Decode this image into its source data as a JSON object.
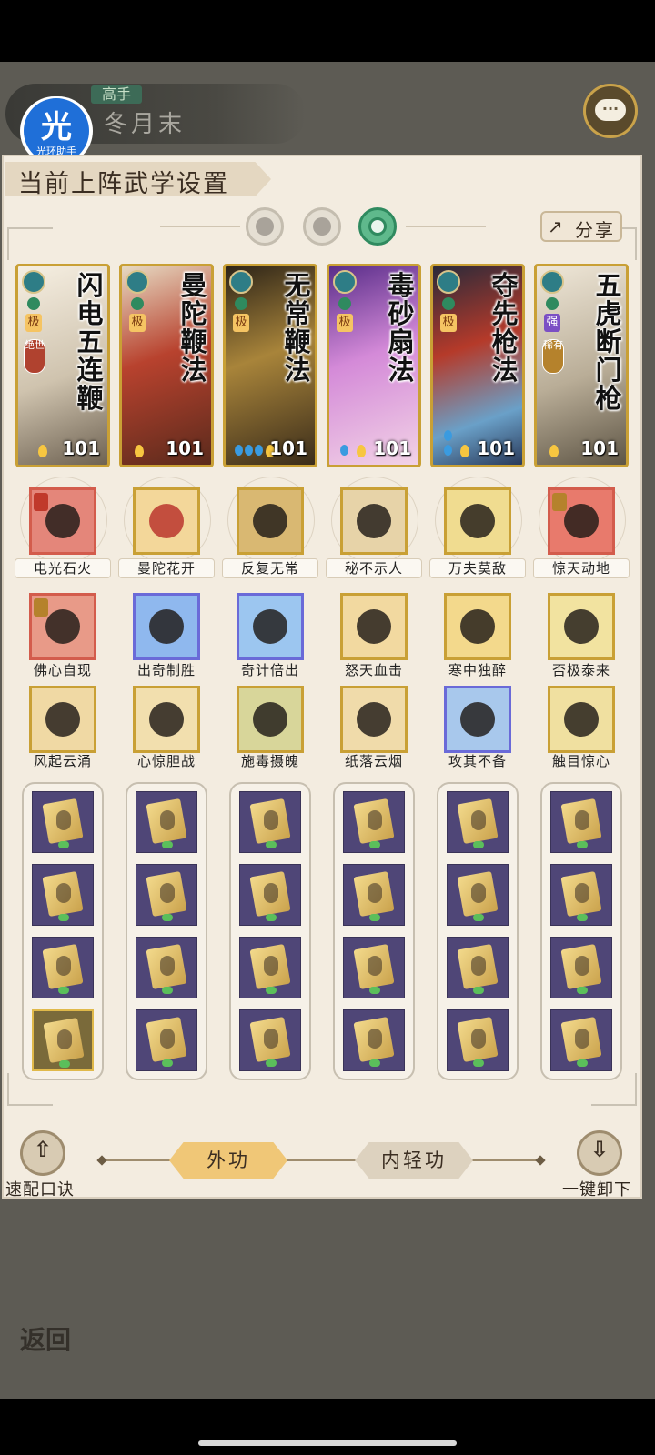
{
  "header": {
    "rank": "高手",
    "player_name": "冬月末",
    "assistant_glyph": "光",
    "assistant_caption": "光环助手"
  },
  "panel": {
    "title": "当前上阵武学设置",
    "share_label": "分享",
    "share_icon": "share-icon"
  },
  "cards": [
    {
      "name": "闪电五连鞭",
      "grade": "极",
      "seal": "绝世",
      "level": "101",
      "drops": 0
    },
    {
      "name": "曼陀鞭法",
      "grade": "极",
      "seal": "",
      "level": "101",
      "drops": 0
    },
    {
      "name": "无常鞭法",
      "grade": "极",
      "seal": "",
      "level": "101",
      "drops": 3
    },
    {
      "name": "毒砂扇法",
      "grade": "极",
      "seal": "",
      "level": "101",
      "drops": 1
    },
    {
      "name": "夺先枪法",
      "grade": "极",
      "seal": "",
      "level": "101",
      "drops": 2
    },
    {
      "name": "五虎断门枪",
      "grade": "强",
      "seal": "稀有",
      "level": "101",
      "drops": 0
    }
  ],
  "ultimates": [
    "电光石火",
    "曼陀花开",
    "反复无常",
    "秘不示人",
    "万夫莫敌",
    "惊天动地"
  ],
  "techniques_row1": [
    "佛心自现",
    "出奇制胜",
    "奇计倍出",
    "怒天血击",
    "寒中独醉",
    "否极泰来"
  ],
  "techniques_row2": [
    "风起云涌",
    "心惊胆战",
    "施毒摄魄",
    "纸落云烟",
    "攻其不备",
    "触目惊心"
  ],
  "controls": {
    "quick_config": "速配口诀",
    "unequip_all": "一键卸下",
    "tab_outer": "外功",
    "tab_inner": "内轻功",
    "back": "返回"
  },
  "colors": {
    "panel_bg": "#f3ece0",
    "gold_border": "#c9a035",
    "active_mode": "#2f8a5f",
    "scroll_bg": "#4f4677"
  }
}
